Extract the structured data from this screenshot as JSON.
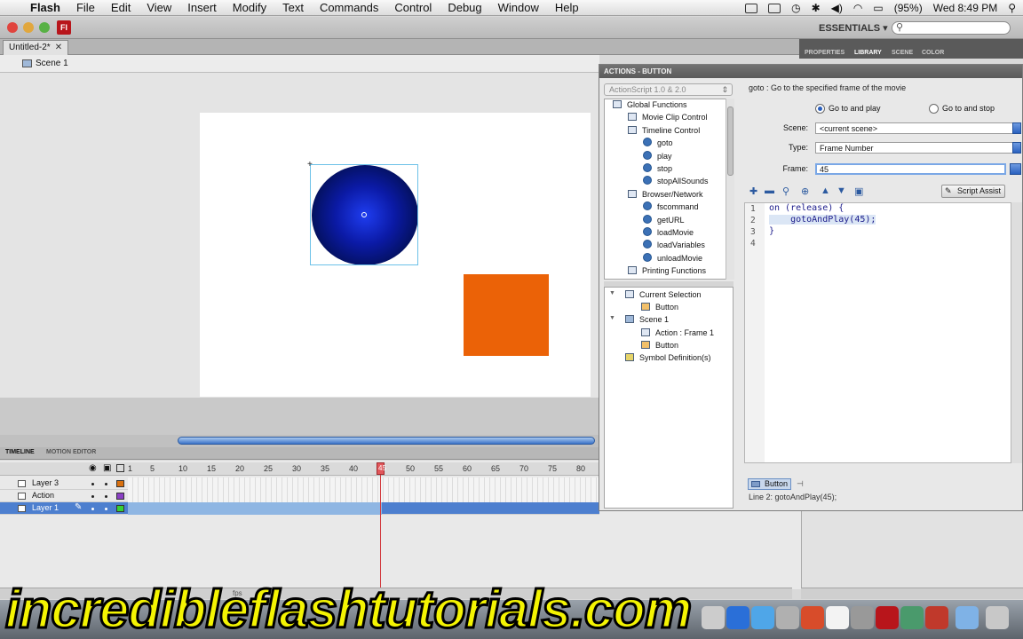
{
  "menubar": {
    "app_name": "Flash",
    "items": [
      "File",
      "Edit",
      "View",
      "Insert",
      "Modify",
      "Text",
      "Commands",
      "Control",
      "Debug",
      "Window",
      "Help"
    ],
    "battery": "(95%)",
    "clock": "Wed 8:49 PM"
  },
  "app": {
    "logo": "Fl",
    "workspace": "ESSENTIALS ▾",
    "search_glyph": "⚲"
  },
  "document": {
    "tab_title": "Untitled-2*",
    "tab_close": "✕",
    "scene": "Scene 1"
  },
  "panels": {
    "tabs": [
      "PROPERTIES",
      "LIBRARY",
      "SCENE",
      "COLOR"
    ]
  },
  "timeline": {
    "tab_timeline": "TIMELINE",
    "tab_motion": "MOTION EDITOR",
    "frame_numbers": [
      "1",
      "5",
      "10",
      "15",
      "20",
      "25",
      "30",
      "35",
      "40",
      "45",
      "50",
      "55",
      "60",
      "65",
      "70",
      "75",
      "80"
    ],
    "current_frame": 45,
    "layers": [
      {
        "name": "Layer 3",
        "color": "#d9700f",
        "selected": false
      },
      {
        "name": "Action",
        "color": "#8a3fc4",
        "selected": false
      },
      {
        "name": "Layer 1",
        "color": "#37d036",
        "selected": true
      }
    ],
    "fps_label": "fps"
  },
  "actions_panel": {
    "title": "ACTIONS - BUTTON",
    "as_version": "ActionScript 1.0 & 2.0",
    "toolbox": [
      {
        "label": "Global Functions",
        "kind": "book",
        "indent": 0
      },
      {
        "label": "Movie Clip Control",
        "kind": "book",
        "indent": 1
      },
      {
        "label": "Timeline Control",
        "kind": "book",
        "indent": 1
      },
      {
        "label": "goto",
        "kind": "fn",
        "indent": 2
      },
      {
        "label": "play",
        "kind": "fn",
        "indent": 2
      },
      {
        "label": "stop",
        "kind": "fn",
        "indent": 2
      },
      {
        "label": "stopAllSounds",
        "kind": "fn",
        "indent": 2
      },
      {
        "label": "Browser/Network",
        "kind": "book",
        "indent": 1
      },
      {
        "label": "fscommand",
        "kind": "fn",
        "indent": 2
      },
      {
        "label": "getURL",
        "kind": "fn",
        "indent": 2
      },
      {
        "label": "loadMovie",
        "kind": "fn",
        "indent": 2
      },
      {
        "label": "loadVariables",
        "kind": "fn",
        "indent": 2
      },
      {
        "label": "unloadMovie",
        "kind": "fn",
        "indent": 2
      },
      {
        "label": "Printing Functions",
        "kind": "book",
        "indent": 1
      }
    ],
    "navigator": [
      {
        "label": "Current Selection",
        "indent": 0
      },
      {
        "label": "Button",
        "indent": 1
      },
      {
        "label": "Scene 1",
        "indent": 0
      },
      {
        "label": "Action : Frame 1",
        "indent": 1
      },
      {
        "label": "Button",
        "indent": 1
      },
      {
        "label": "Symbol Definition(s)",
        "indent": 0
      }
    ],
    "help_text": "goto : Go to the specified frame of the movie",
    "radio_play": "Go to and play",
    "radio_stop": "Go to and stop",
    "scene_label": "Scene:",
    "scene_value": "<current scene>",
    "type_label": "Type:",
    "type_value": "Frame Number",
    "frame_label": "Frame:",
    "frame_value": "45",
    "script_assist": "Script Assist",
    "code": [
      {
        "line": "1",
        "text": "on (release) {"
      },
      {
        "line": "2",
        "text": "    gotoAndPlay(45);"
      },
      {
        "line": "3",
        "text": "}"
      },
      {
        "line": "4",
        "text": ""
      }
    ],
    "script_tab": "Button",
    "status": "Line 2: gotoAndPlay(45);"
  },
  "watermark": "incredibleflashtutorials.com",
  "colors": {
    "circle": "#0b1aa6",
    "square": "#eb6207",
    "selection": "#6cc1e8"
  }
}
